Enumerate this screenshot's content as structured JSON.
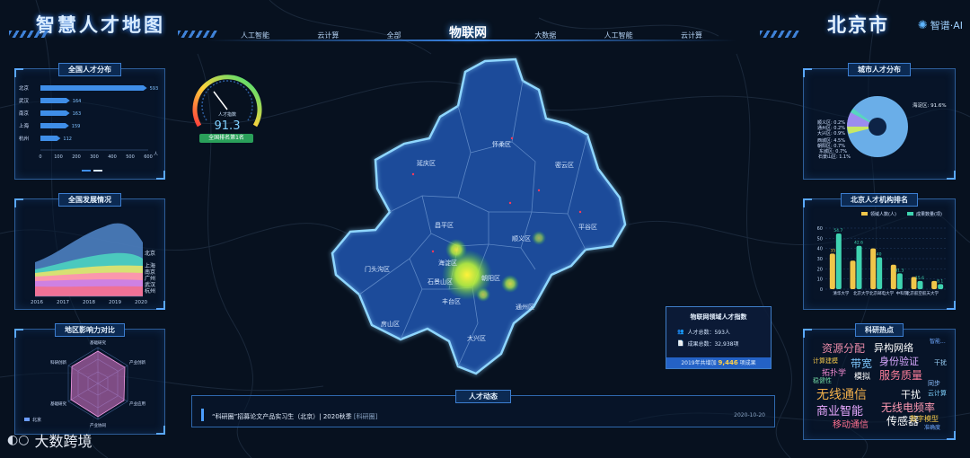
{
  "header": {
    "title": "智慧人才地图",
    "city": "北京市",
    "logo": "智谱·AI",
    "nav": [
      "人工智能",
      "云计算",
      "全部",
      "物联网",
      "大数据",
      "人工智能",
      "云计算"
    ],
    "nav_active": "物联网"
  },
  "gauge": {
    "value": "91.3",
    "label": "人才指数",
    "badge": "全国排名第1名",
    "fraction": 0.913
  },
  "national_talent": {
    "title": "全国人才分布",
    "cities": [
      "北京",
      "武汉",
      "南京",
      "上海",
      "杭州"
    ],
    "values": [
      593,
      164,
      163,
      159,
      112
    ],
    "ticks": [
      "0",
      "100",
      "200",
      "300",
      "400",
      "500",
      "600"
    ],
    "unit": "人"
  },
  "national_dev": {
    "title": "全国发展情况",
    "years": [
      "2016",
      "2017",
      "2018",
      "2019",
      "2020"
    ],
    "legend": [
      "北京",
      "上海",
      "南京",
      "广州",
      "武汉",
      "杭州"
    ]
  },
  "influence": {
    "title": "地区影响力对比",
    "axes": [
      "基础研究",
      "产业创新",
      "产业应用",
      "产业协同",
      "基础研究",
      "科研创新"
    ],
    "legend": "北京"
  },
  "city_talent": {
    "title": "城市人才分布",
    "main_label": "海淀区: 91.6%",
    "labels": [
      "顺义区: 0.2%",
      "通州区: 0.2%",
      "大兴区: 0.9%",
      "西城区: 4.5%",
      "朝阳区: 0.7%",
      "东城区: 0.7%",
      "石景山区: 1.1%"
    ]
  },
  "institutions": {
    "title": "北京人才机构排名",
    "legend": [
      "领域人数(人)",
      "成果数量(项)"
    ],
    "yticks": [
      "0",
      "10",
      "20",
      "30",
      "40",
      "50",
      "60"
    ],
    "categories": [
      "清华大学",
      "北京大学",
      "北京邮电大学",
      "中科院",
      "北京航空航天大学"
    ],
    "people": [
      35,
      28,
      40,
      24,
      12,
      8
    ],
    "results": [
      54.7,
      42.6,
      31.3,
      15.6,
      8.1,
      5
    ],
    "labels_people": [
      "35",
      "",
      "",
      "",
      "",
      ""
    ],
    "labels_results": [
      "54.7",
      "42.6",
      "40",
      "31.3",
      "15.6",
      "8.1"
    ]
  },
  "hot_topics": {
    "title": "科研热点",
    "words": [
      {
        "t": "资源分配",
        "c": "#e98aa8",
        "s": 12
      },
      {
        "t": "异构网络",
        "c": "#ffffff",
        "s": 11
      },
      {
        "t": "智能...",
        "c": "#6ea8ff",
        "s": 6
      },
      {
        "t": "计算建模",
        "c": "#f0c64a",
        "s": 7
      },
      {
        "t": "带宽",
        "c": "#7fc9ff",
        "s": 12
      },
      {
        "t": "身份验证",
        "c": "#d8a8ff",
        "s": 11
      },
      {
        "t": "干扰",
        "c": "#9fd7ff",
        "s": 7
      },
      {
        "t": "拓扑学",
        "c": "#f08ad0",
        "s": 9
      },
      {
        "t": "模拟",
        "c": "#ffffff",
        "s": 9
      },
      {
        "t": "服务质量",
        "c": "#ff7f9c",
        "s": 12
      },
      {
        "t": "稳健性",
        "c": "#6fd3a0",
        "s": 7
      },
      {
        "t": "同步",
        "c": "#8ec0ff",
        "s": 7
      },
      {
        "t": "无线通信",
        "c": "#f3b04b",
        "s": 14
      },
      {
        "t": "干扰",
        "c": "#ffffff",
        "s": 11
      },
      {
        "t": "云计算",
        "c": "#7fd3ff",
        "s": 7
      },
      {
        "t": "商业智能",
        "c": "#e8a8ff",
        "s": 13
      },
      {
        "t": "无线电频率",
        "c": "#ff9ab3",
        "s": 12
      },
      {
        "t": "移动通信",
        "c": "#ff6f8f",
        "s": 10
      },
      {
        "t": "传感器",
        "c": "#ffffff",
        "s": 12
      },
      {
        "t": "数字模型",
        "c": "#f0c64a",
        "s": 8
      },
      {
        "t": "准确度",
        "c": "#6fa8ff",
        "s": 6
      }
    ]
  },
  "index_card": {
    "title": "物联网领域人才指数",
    "people_label": "人才总数：593人",
    "results_label": "成果总数：32,938项",
    "foot_prefix": "2019年共增加 ",
    "foot_value": "9,446",
    "foot_suffix": " 项成果"
  },
  "news": {
    "title": "人才动态",
    "text": "“科研圈”招募论文产品实习生（北京）| 2020秋季",
    "source": "[科研圈]",
    "date": "2020-10-20"
  },
  "districts": [
    "延庆区",
    "怀柔区",
    "密云区",
    "昌平区",
    "平谷区",
    "顺义区",
    "门头沟区",
    "海淀区",
    "石景山区",
    "朝阳区",
    "丰台区",
    "通州区",
    "房山区",
    "大兴区"
  ],
  "watermark": "大数跨境"
}
